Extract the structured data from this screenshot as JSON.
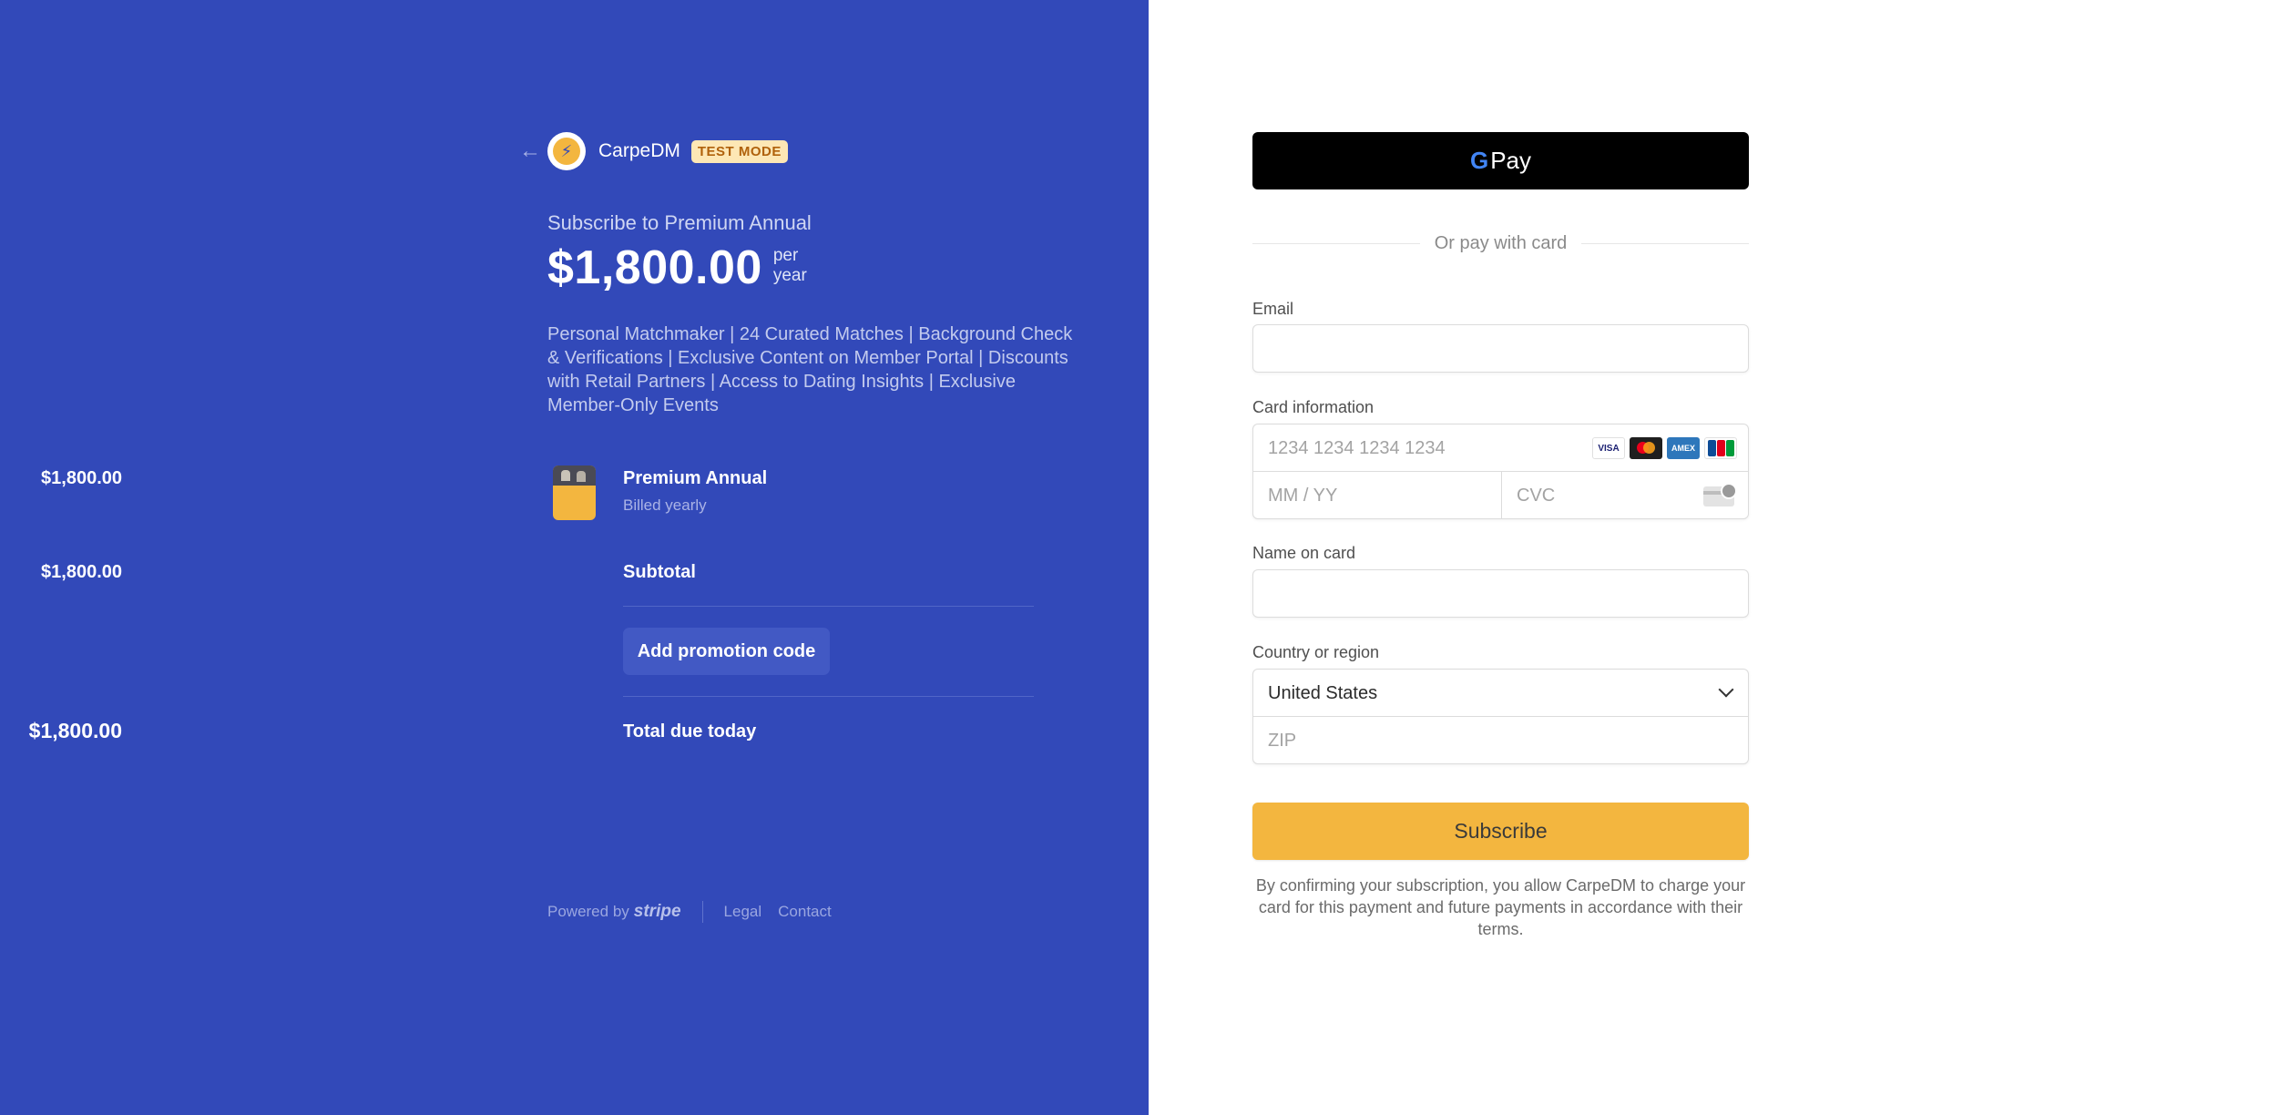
{
  "colors": {
    "left_background": "#3249b9",
    "accent": "#f3b63f",
    "test_mode_badge": "#fde7b5"
  },
  "header": {
    "back_icon": "arrow-left-icon",
    "logo_icon": "lightning-bolt-logo",
    "brand": "CarpeDM",
    "badge": "TEST MODE"
  },
  "summary": {
    "subscribe_to": "Subscribe to Premium Annual",
    "price": "$1,800.00",
    "per": "per",
    "period": "year",
    "description": "Personal Matchmaker | 24 Curated Matches | Background Check & Verifications | Exclusive Content on Member Portal | Discounts with Retail Partners | Access to Dating Insights | Exclusive Member-Only Events"
  },
  "line_item": {
    "name": "Premium Annual",
    "billing": "Billed yearly",
    "price": "$1,800.00"
  },
  "totals": {
    "subtotal_label": "Subtotal",
    "subtotal_value": "$1,800.00",
    "promo_label": "Add promotion code",
    "total_label": "Total due today",
    "total_value": "$1,800.00"
  },
  "footer": {
    "powered_by": "Powered by",
    "stripe": "stripe",
    "legal": "Legal",
    "contact": "Contact"
  },
  "form": {
    "gpay_label": "Pay",
    "or_text": "Or pay with card",
    "email_label": "Email",
    "card_label": "Card information",
    "card_number_placeholder": "1234 1234 1234 1234",
    "expiry_placeholder": "MM / YY",
    "cvc_placeholder": "CVC",
    "card_brands": [
      "VISA",
      "mastercard",
      "AMEX",
      "JCB"
    ],
    "name_label": "Name on card",
    "country_label": "Country or region",
    "country_value": "United States",
    "zip_placeholder": "ZIP",
    "subscribe_label": "Subscribe",
    "terms": "By confirming your subscription, you allow CarpeDM to charge your card for this payment and future payments in accordance with their terms."
  }
}
